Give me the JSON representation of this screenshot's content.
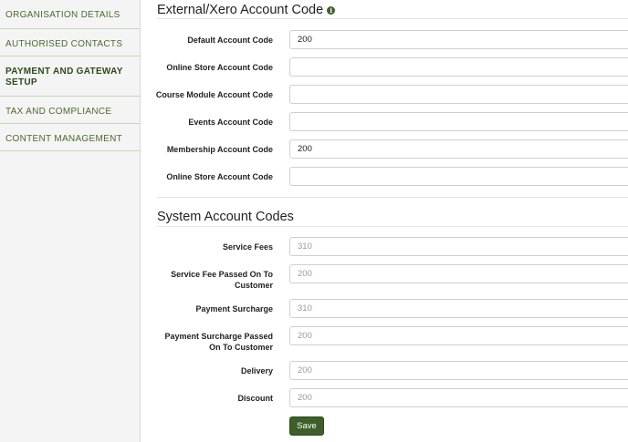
{
  "sidebar": {
    "items": [
      {
        "label": "ORGANISATION DETAILS"
      },
      {
        "label": "AUTHORISED CONTACTS"
      },
      {
        "label": "PAYMENT AND GATEWAY SETUP"
      },
      {
        "label": "TAX AND COMPLIANCE"
      },
      {
        "label": "CONTENT MANAGEMENT"
      }
    ]
  },
  "external": {
    "title": "External/Xero Account Code",
    "info_icon": "info-icon",
    "fields": [
      {
        "label": "Default Account Code",
        "value": "200"
      },
      {
        "label": "Online Store Account Code",
        "value": ""
      },
      {
        "label": "Course Module Account Code",
        "value": ""
      },
      {
        "label": "Events Account Code",
        "value": ""
      },
      {
        "label": "Membership Account Code",
        "value": "200"
      },
      {
        "label": "Online Store Account Code",
        "value": ""
      }
    ]
  },
  "system": {
    "title": "System Account Codes",
    "fields": [
      {
        "label": "Service Fees",
        "placeholder": "310"
      },
      {
        "label": "Service Fee Passed On To Customer",
        "placeholder": "200"
      },
      {
        "label": "Payment Surcharge",
        "placeholder": "310"
      },
      {
        "label": "Payment Surcharge Passed On To Customer",
        "placeholder": "200"
      },
      {
        "label": "Delivery",
        "placeholder": "200"
      },
      {
        "label": "Discount",
        "placeholder": "200"
      }
    ]
  },
  "save_label": "Save",
  "colors": {
    "accent": "#3f5f2a",
    "sidebar_text": "#4a6b2e"
  }
}
